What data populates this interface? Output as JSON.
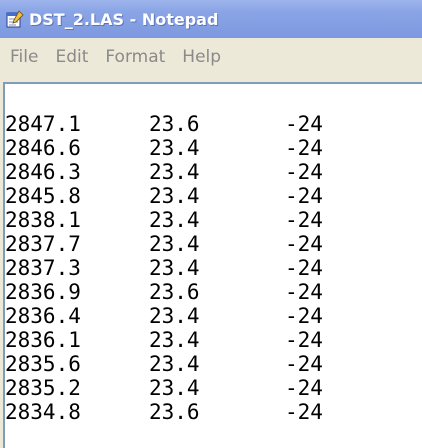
{
  "window": {
    "title": "DST_2.LAS - Notepad",
    "icon": "notepad-icon",
    "titlebar_color": "#8aa5e6",
    "menubar_color": "#ece9d8",
    "border_color": "#7f9db9"
  },
  "menu": {
    "items": [
      {
        "label": "File"
      },
      {
        "label": "Edit"
      },
      {
        "label": "Format"
      },
      {
        "label": "Help"
      }
    ],
    "text_color": "#8a8a8a"
  },
  "document": {
    "rows": [
      {
        "c1": "2847.1",
        "c2": "23.6",
        "c3": "-24"
      },
      {
        "c1": "2846.6",
        "c2": "23.4",
        "c3": "-24"
      },
      {
        "c1": "2846.3",
        "c2": "23.4",
        "c3": "-24"
      },
      {
        "c1": "2845.8",
        "c2": "23.4",
        "c3": "-24"
      },
      {
        "c1": "2838.1",
        "c2": "23.4",
        "c3": "-24"
      },
      {
        "c1": "2837.7",
        "c2": "23.4",
        "c3": "-24"
      },
      {
        "c1": "2837.3",
        "c2": "23.4",
        "c3": "-24"
      },
      {
        "c1": "2836.9",
        "c2": "23.6",
        "c3": "-24"
      },
      {
        "c1": "2836.4",
        "c2": "23.4",
        "c3": "-24"
      },
      {
        "c1": "2836.1",
        "c2": "23.4",
        "c3": "-24"
      },
      {
        "c1": "2835.6",
        "c2": "23.4",
        "c3": "-24"
      },
      {
        "c1": "2835.2",
        "c2": "23.4",
        "c3": "-24"
      },
      {
        "c1": "2834.8",
        "c2": "23.6",
        "c3": "-24"
      }
    ]
  }
}
